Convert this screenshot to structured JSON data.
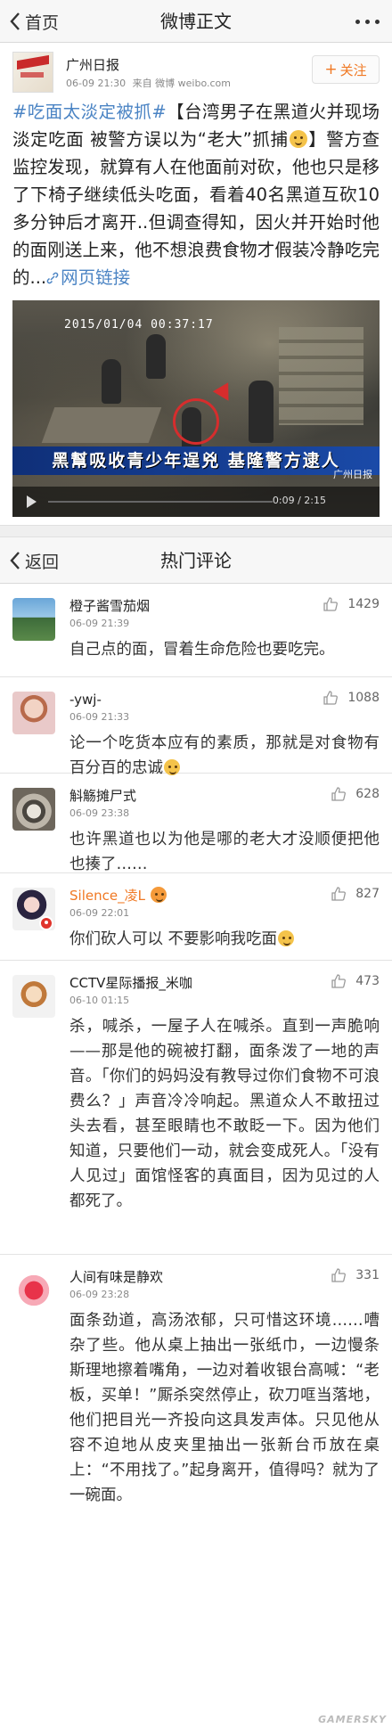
{
  "nav": {
    "back_label": "首页",
    "title": "微博正文"
  },
  "post": {
    "author": "广州日报",
    "time": "06-09 21:30",
    "source": "来自 微博 weibo.com",
    "follow_label": "关注",
    "topic": "#吃面太淡定被抓#",
    "text_1": "【台湾男子在黑道火并现场淡定吃面 被警方误以为“老大”抓捕",
    "text_2": "】警方查监控发现，就算有人在他面前对砍，他也只是移了下椅子继续低头吃面，看着40名黑道互砍10多分钟后才离开..但调查得知，因火并开始时他的面刚送上来，他不想浪费食物才假装冷静吃完的...",
    "link_label": "网页链接",
    "video": {
      "timestamp": "2015/01/04  00:37:17",
      "banner": "黑幫吸收青少年逞兇 基隆警方逮人",
      "time": "0:09 / 2:15",
      "watermark": "广州日报"
    }
  },
  "comments_nav": {
    "back_label": "返回",
    "title": "热门评论"
  },
  "comments": [
    {
      "name": "橙子酱雪茄烟",
      "time": "06-09 21:39",
      "likes": "1429",
      "text": "自己点的面，冒着生命危险也要吃完。"
    },
    {
      "name": "-ywj-",
      "time": "06-09 21:33",
      "likes": "1088",
      "text": "论一个吃货本应有的素质，那就是对食物有百分百的忠诚"
    },
    {
      "name": "斛觞摊尸式",
      "time": "06-09 23:38",
      "likes": "628",
      "text": "也许黑道也以为他是哪的老大才没顺便把他也揍了……"
    },
    {
      "name": "Silence_凌L",
      "time": "06-09 22:01",
      "likes": "827",
      "text": "你们砍人可以 不要影响我吃面"
    },
    {
      "name": "CCTV星际播报_米咖",
      "time": "06-10 01:15",
      "likes": "473",
      "text": "杀，喊杀，一屋子人在喊杀。直到一声脆响——那是他的碗被打翻，面条泼了一地的声音。「你们的妈妈没有教导过你们食物不可浪费么？」声音冷冷响起。黑道众人不敢扭过头去看，甚至眼睛也不敢眨一下。因为他们知道，只要他们一动，就会变成死人。「没有人见过」面馆怪客的真面目，因为见过的人都死了。"
    },
    {
      "name": "人间有味是静欢",
      "time": "06-09 23:28",
      "likes": "331",
      "text": "面条劲道，高汤浓郁，只可惜这环境……嘈杂了些。他从桌上抽出一张纸巾，一边慢条斯理地擦着嘴角，一边对着收银台高喊：“老板，买单！”厮杀突然停止，砍刀哐当落地，他们把目光一齐投向这具发声体。只见他从容不迫地从皮夹里抽出一张新台币放在桌上：“不用找了。”起身离开，值得吗？就为了一碗面。"
    }
  ],
  "watermark": "GAMERSKY",
  "colors": {
    "link": "#4b84c4",
    "accent": "#f07823"
  }
}
